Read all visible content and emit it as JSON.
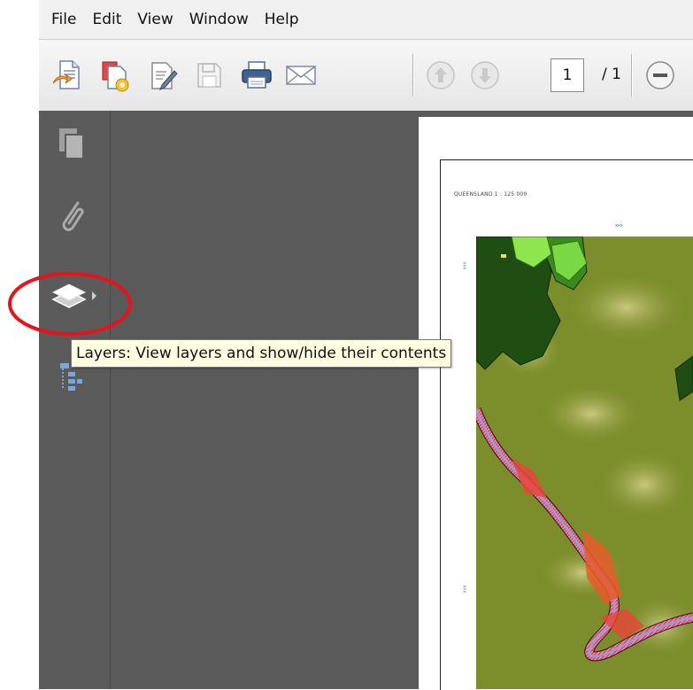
{
  "menu": {
    "items": [
      "File",
      "Edit",
      "View",
      "Window",
      "Help"
    ]
  },
  "toolbar": {
    "buttons": [
      "create-icon",
      "convert-icon",
      "edit-icon",
      "save-icon",
      "print-icon",
      "email-icon",
      "page-up-icon",
      "page-down-icon",
      "zoom-out-icon"
    ],
    "page_current": "1",
    "page_total": "/ 1"
  },
  "nav": {
    "buttons": [
      "pages-icon",
      "attachments-icon",
      "layers-icon",
      "structure-icon"
    ]
  },
  "tooltip": {
    "text": "Layers: View layers and show/hide their contents"
  },
  "document": {
    "map_title": "QUEENSLAND 1 : 125 000",
    "top_tick": "xxx",
    "left_tick_1": "xxx",
    "left_tick_2": "xxx"
  },
  "colors": {
    "highlight_ring": "#e5141a",
    "nav_pane": "#5b5b5b",
    "doc_bg": "#5a5a5a",
    "tooltip_bg": "#ffffe1"
  }
}
